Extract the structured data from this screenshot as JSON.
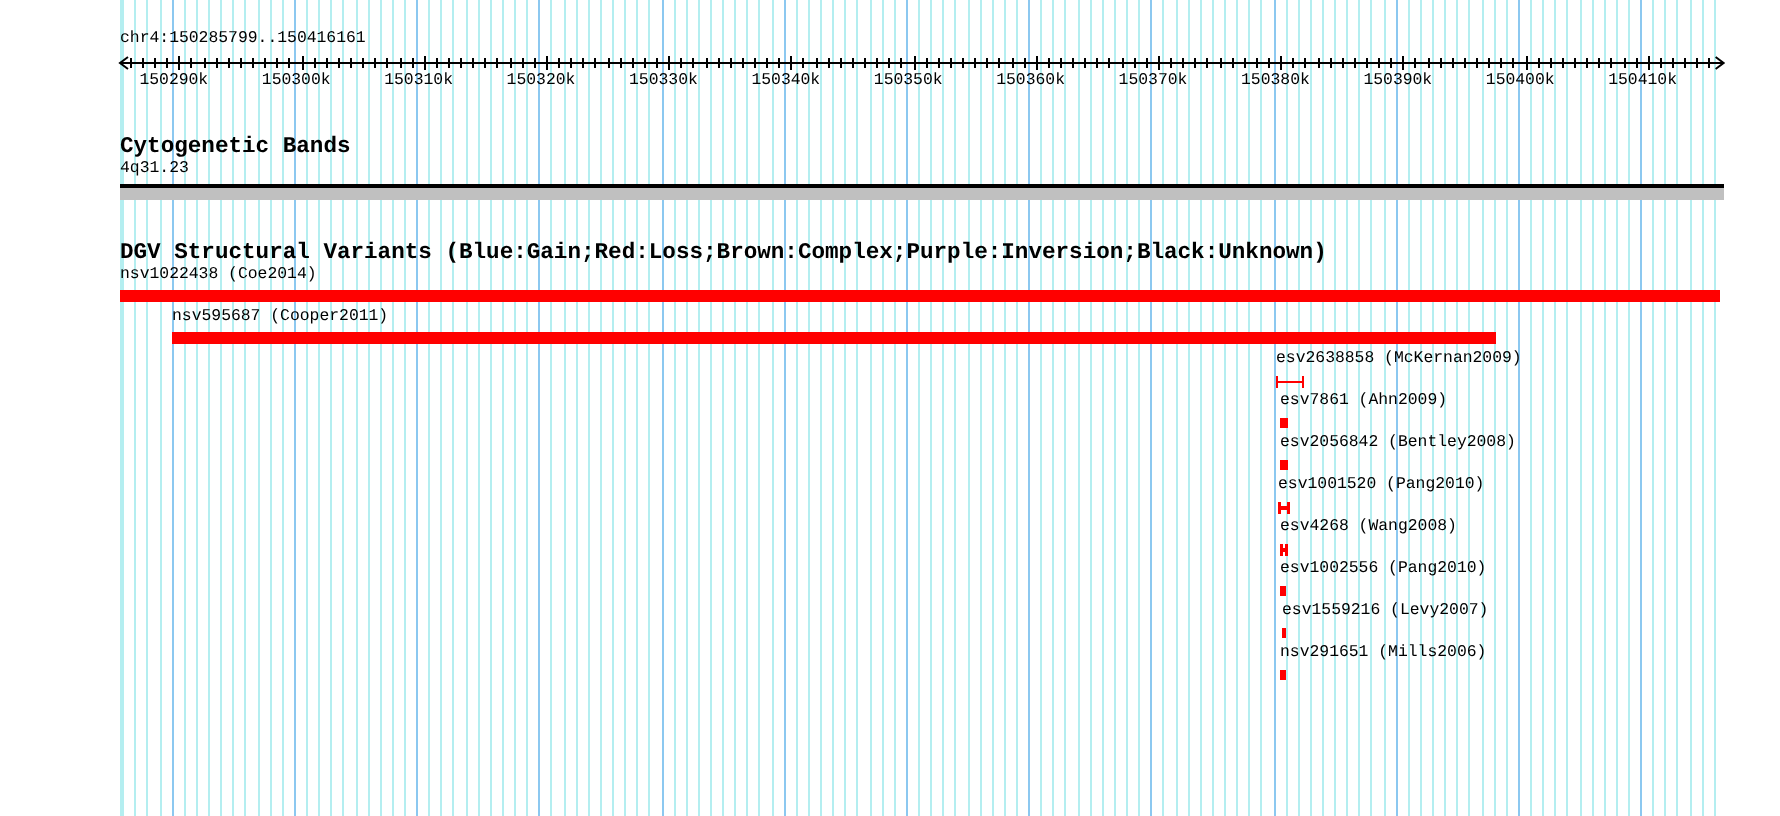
{
  "ruler": {
    "label": "chr4:150285799..150416161",
    "ticks": [
      "150290k",
      "150300k",
      "150310k",
      "150320k",
      "150330k",
      "150340k",
      "150350k",
      "150360k",
      "150370k",
      "150380k",
      "150390k",
      "150400k",
      "150410k"
    ]
  },
  "tracks": [
    {
      "kind": "bands",
      "title": "Cytogenetic Bands",
      "features": [
        {
          "label": "4q31.23"
        }
      ]
    },
    {
      "kind": "variants",
      "title": "DGV Structural Variants (Blue:Gain;Red:Loss;Brown:Complex;Purple:Inversion;Black:Unknown)",
      "features": [
        {
          "label": "nsv1022438 (Coe2014)",
          "kind": "block",
          "color": "#ff0000"
        },
        {
          "label": "nsv595687 (Cooper2011)",
          "kind": "block",
          "color": "#ff0000"
        },
        {
          "label": "esv2638858 (McKernan2009)",
          "kind": "span",
          "color": "#ff0000"
        },
        {
          "label": "esv7861 (Ahn2009)",
          "kind": "block",
          "color": "#ff0000"
        },
        {
          "label": "esv2056842 (Bentley2008)",
          "kind": "block",
          "color": "#ff0000"
        },
        {
          "label": "esv1001520 (Pang2010)",
          "kind": "span",
          "color": "#ff0000"
        },
        {
          "label": "esv4268 (Wang2008)",
          "kind": "span",
          "color": "#ff0000"
        },
        {
          "label": "esv1002556 (Pang2010)",
          "kind": "block",
          "color": "#ff0000"
        },
        {
          "label": "esv1559216 (Levy2007)",
          "kind": "block",
          "color": "#ff0000"
        },
        {
          "label": "nsv291651 (Mills2006)",
          "kind": "block",
          "color": "#ff0000"
        }
      ]
    }
  ]
}
